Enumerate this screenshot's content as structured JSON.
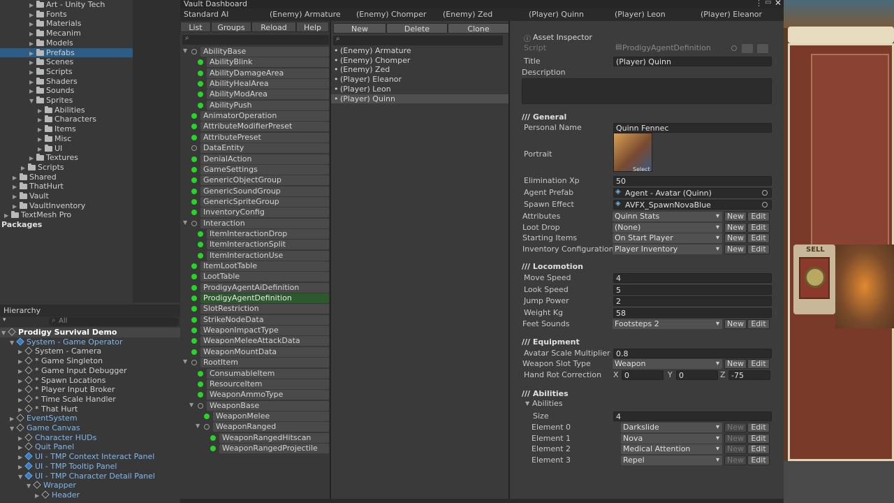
{
  "project": {
    "items": [
      {
        "label": "Art - Unity Tech",
        "indent": 3,
        "type": "folder"
      },
      {
        "label": "Fonts",
        "indent": 3,
        "type": "folder"
      },
      {
        "label": "Materials",
        "indent": 3,
        "type": "folder"
      },
      {
        "label": "Mecanim",
        "indent": 3,
        "type": "folder"
      },
      {
        "label": "Models",
        "indent": 3,
        "type": "folder"
      },
      {
        "label": "Prefabs",
        "indent": 3,
        "type": "folder",
        "selected": true
      },
      {
        "label": "Scenes",
        "indent": 3,
        "type": "folder"
      },
      {
        "label": "Scripts",
        "indent": 3,
        "type": "folder"
      },
      {
        "label": "Shaders",
        "indent": 3,
        "type": "folder"
      },
      {
        "label": "Sounds",
        "indent": 3,
        "type": "folder"
      },
      {
        "label": "Sprites",
        "indent": 3,
        "type": "folder",
        "open": true
      },
      {
        "label": "Abilities",
        "indent": 4,
        "type": "folder"
      },
      {
        "label": "Characters",
        "indent": 4,
        "type": "folder"
      },
      {
        "label": "Items",
        "indent": 4,
        "type": "folder"
      },
      {
        "label": "Misc",
        "indent": 4,
        "type": "folder"
      },
      {
        "label": "UI",
        "indent": 4,
        "type": "folder"
      },
      {
        "label": "Textures",
        "indent": 3,
        "type": "folder"
      },
      {
        "label": "Scripts",
        "indent": 2,
        "type": "folder"
      },
      {
        "label": "Shared",
        "indent": 1,
        "type": "folder"
      },
      {
        "label": "ThatHurt",
        "indent": 1,
        "type": "folder"
      },
      {
        "label": "Vault",
        "indent": 1,
        "type": "folder"
      },
      {
        "label": "VaultInventory",
        "indent": 1,
        "type": "folder"
      },
      {
        "label": "TextMesh Pro",
        "indent": 0,
        "type": "folder"
      },
      {
        "label": "Packages",
        "indent": 0,
        "type": "bold"
      }
    ]
  },
  "hierarchy": {
    "title": "Hierarchy",
    "search_placeholder": "All",
    "items": [
      {
        "label": "Prodigy Survival Demo",
        "indent": 0,
        "kind": "scene"
      },
      {
        "label": "System - Game Operator",
        "indent": 1,
        "kind": "blue"
      },
      {
        "label": "System - Camera",
        "indent": 2,
        "kind": "obj"
      },
      {
        "label": "* Game Singleton",
        "indent": 2,
        "kind": "obj"
      },
      {
        "label": "* Game Input Debugger",
        "indent": 2,
        "kind": "obj"
      },
      {
        "label": "* Spawn Locations",
        "indent": 2,
        "kind": "obj"
      },
      {
        "label": "* Player Input Broker",
        "indent": 2,
        "kind": "obj"
      },
      {
        "label": "* Time Scale Handler",
        "indent": 2,
        "kind": "obj"
      },
      {
        "label": "* That Hurt",
        "indent": 2,
        "kind": "obj"
      },
      {
        "label": "EventSystem",
        "indent": 1,
        "kind": "obj"
      },
      {
        "label": "Game Canvas",
        "indent": 1,
        "kind": "obj"
      },
      {
        "label": "Character HUDs",
        "indent": 2,
        "kind": "obj"
      },
      {
        "label": "Quit Panel",
        "indent": 2,
        "kind": "obj"
      },
      {
        "label": "UI - TMP Context Interact Panel",
        "indent": 2,
        "kind": "blue"
      },
      {
        "label": "UI - TMP Tooltip Panel",
        "indent": 2,
        "kind": "blue"
      },
      {
        "label": "UI - TMP Character Detail Panel",
        "indent": 2,
        "kind": "blue"
      },
      {
        "label": "Wrapper",
        "indent": 3,
        "kind": "obj"
      },
      {
        "label": "Header",
        "indent": 4,
        "kind": "obj"
      }
    ]
  },
  "dashboard": {
    "window_title": "Vault Dashboard",
    "tabs": [
      "Standard AI",
      "(Enemy) Armature",
      "(Enemy) Chomper",
      "(Enemy) Zed",
      "(Player) Quinn",
      "(Player) Leon",
      "(Player) Eleanor"
    ],
    "left_buttons": [
      "List",
      "Groups",
      "Reload",
      "Help"
    ],
    "mid_buttons": [
      "New",
      "Delete",
      "Clone"
    ],
    "types": [
      {
        "label": "AbilityBase",
        "indent": 0,
        "dot": "o",
        "fold": true
      },
      {
        "label": "AbilityBlink",
        "indent": 1,
        "dot": "g"
      },
      {
        "label": "AbilityDamageArea",
        "indent": 1,
        "dot": "g"
      },
      {
        "label": "AbilityHealArea",
        "indent": 1,
        "dot": "g"
      },
      {
        "label": "AbilityModArea",
        "indent": 1,
        "dot": "g"
      },
      {
        "label": "AbilityPush",
        "indent": 1,
        "dot": "g"
      },
      {
        "label": "AnimatorOperation",
        "indent": 0,
        "dot": "g"
      },
      {
        "label": "AttributeModifierPreset",
        "indent": 0,
        "dot": "g"
      },
      {
        "label": "AttributePreset",
        "indent": 0,
        "dot": "g"
      },
      {
        "label": "DataEntity",
        "indent": 0,
        "dot": "o"
      },
      {
        "label": "DenialAction",
        "indent": 0,
        "dot": "g"
      },
      {
        "label": "GameSettings",
        "indent": 0,
        "dot": "g"
      },
      {
        "label": "GenericObjectGroup",
        "indent": 0,
        "dot": "g"
      },
      {
        "label": "GenericSoundGroup",
        "indent": 0,
        "dot": "g"
      },
      {
        "label": "GenericSpriteGroup",
        "indent": 0,
        "dot": "g"
      },
      {
        "label": "InventoryConfig",
        "indent": 0,
        "dot": "g"
      },
      {
        "label": "Interaction",
        "indent": 0,
        "dot": "o",
        "fold": true
      },
      {
        "label": "ItemInteractionDrop",
        "indent": 1,
        "dot": "g"
      },
      {
        "label": "ItemInteractionSplit",
        "indent": 1,
        "dot": "g"
      },
      {
        "label": "ItemInteractionUse",
        "indent": 1,
        "dot": "g"
      },
      {
        "label": "ItemLootTable",
        "indent": 0,
        "dot": "g"
      },
      {
        "label": "LootTable",
        "indent": 0,
        "dot": "g"
      },
      {
        "label": "ProdigyAgentAiDefinition",
        "indent": 0,
        "dot": "g"
      },
      {
        "label": "ProdigyAgentDefinition",
        "indent": 0,
        "dot": "g",
        "selected": true
      },
      {
        "label": "SlotRestriction",
        "indent": 0,
        "dot": "g"
      },
      {
        "label": "StrikeNodeData",
        "indent": 0,
        "dot": "g"
      },
      {
        "label": "WeaponImpactType",
        "indent": 0,
        "dot": "g"
      },
      {
        "label": "WeaponMeleeAttackData",
        "indent": 0,
        "dot": "g"
      },
      {
        "label": "WeaponMountData",
        "indent": 0,
        "dot": "g"
      },
      {
        "label": "RootItem",
        "indent": 0,
        "dot": "o",
        "fold": true
      },
      {
        "label": "ConsumableItem",
        "indent": 1,
        "dot": "g"
      },
      {
        "label": "ResourceItem",
        "indent": 1,
        "dot": "g"
      },
      {
        "label": "WeaponAmmoType",
        "indent": 1,
        "dot": "g"
      },
      {
        "label": "WeaponBase",
        "indent": 1,
        "dot": "o",
        "fold": true
      },
      {
        "label": "WeaponMelee",
        "indent": 2,
        "dot": "g"
      },
      {
        "label": "WeaponRanged",
        "indent": 2,
        "dot": "o",
        "fold": true
      },
      {
        "label": "WeaponRangedHitscan",
        "indent": 3,
        "dot": "g"
      },
      {
        "label": "WeaponRangedProjectile",
        "indent": 3,
        "dot": "g"
      }
    ],
    "assets": [
      "(Enemy) Armature",
      "(Enemy) Chomper",
      "(Enemy) Zed",
      "(Player) Eleanor",
      "(Player) Leon",
      "(Player) Quinn"
    ],
    "selected_asset": "(Player) Quinn"
  },
  "inspector": {
    "title": "Asset Inspector",
    "script_label": "Script",
    "script_value": "ProdigyAgentDefinition",
    "title_label": "Title",
    "title_value": "(Player) Quinn",
    "description_label": "Description",
    "general_header": "/// General",
    "personal_name_label": "Personal Name",
    "personal_name": "Quinn Fennec",
    "portrait_label": "Portrait",
    "portrait_select": "Select",
    "elimination_xp_label": "Elimination Xp",
    "elimination_xp": "50",
    "agent_prefab_label": "Agent Prefab",
    "agent_prefab": "Agent - Avatar (Quinn)",
    "spawn_effect_label": "Spawn Effect",
    "spawn_effect": "AVFX_SpawnNovaBlue",
    "new_label": "New",
    "edit_label": "Edit",
    "dropdowns": [
      {
        "label": "Attributes",
        "value": "Quinn Stats"
      },
      {
        "label": "Loot Drop",
        "value": "(None)"
      },
      {
        "label": "Starting Items",
        "value": "On Start Player"
      },
      {
        "label": "Inventory Configuration",
        "value": "Player Inventory"
      }
    ],
    "locomotion_header": "/// Locomotion",
    "locomotion": [
      {
        "label": "Move Speed",
        "value": "4"
      },
      {
        "label": "Look Speed",
        "value": "5"
      },
      {
        "label": "Jump Power",
        "value": "2"
      },
      {
        "label": "Weight Kg",
        "value": "58"
      }
    ],
    "feet_sounds_label": "Feet Sounds",
    "feet_sounds": "Footsteps 2",
    "equipment_header": "/// Equipment",
    "avatar_scale_label": "Avatar Scale Multiplier",
    "avatar_scale": "0.8",
    "weapon_slot_label": "Weapon Slot Type",
    "weapon_slot": "Weapon",
    "hand_rot_label": "Hand Rot Correction",
    "hand_rot": {
      "x_label": "X",
      "x": "0",
      "y_label": "Y",
      "y": "0",
      "z_label": "Z",
      "z": "-75"
    },
    "abilities_header": "/// Abilities",
    "abilities_fold": "Abilities",
    "size_label": "Size",
    "size": "4",
    "elements": [
      {
        "label": "Element 0",
        "value": "Darkslide"
      },
      {
        "label": "Element 1",
        "value": "Nova"
      },
      {
        "label": "Element 2",
        "value": "Medical Attention"
      },
      {
        "label": "Element 3",
        "value": "Repel"
      }
    ]
  },
  "game_view": {
    "sell_label": "SELL"
  },
  "colors": {
    "selection_blue": "#2c5d87",
    "selection_green": "#2d5a2d",
    "dot_green": "#27d427"
  }
}
